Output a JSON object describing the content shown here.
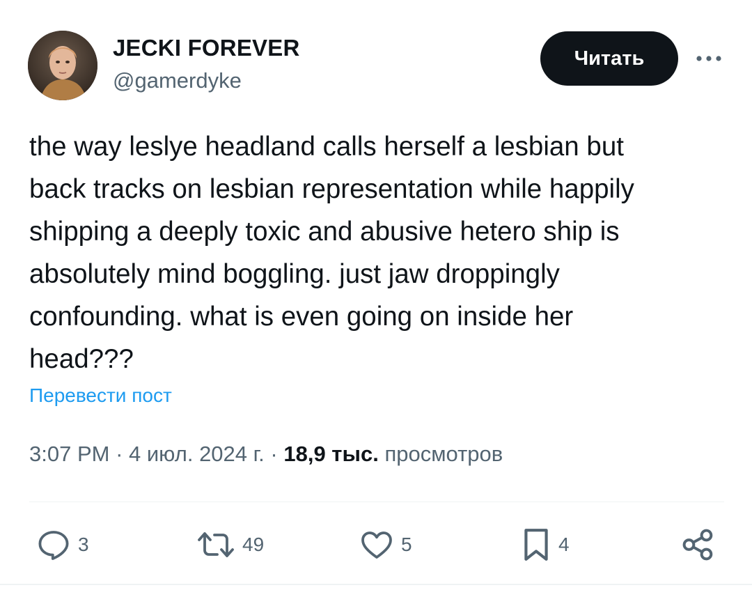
{
  "author": {
    "display_name": "JECKI FOREVER",
    "handle": "@gamerdyke"
  },
  "header": {
    "follow_label": "Читать",
    "more_icon": "more-horizontal-icon"
  },
  "tweet": {
    "lines": [
      "the way leslye headland calls herself a lesbian but",
      "back tracks on lesbian representation while happily",
      "shipping a deeply toxic and abusive hetero ship is",
      "absolutely mind boggling. just jaw droppingly",
      "confounding. what is even going on inside her",
      "head???"
    ],
    "translate_label": "Перевести пост"
  },
  "meta": {
    "time": "3:07 PM",
    "separator": " · ",
    "date": "4 июл. 2024 г.",
    "views_count": "18,9 тыс.",
    "views_label": "просмотров"
  },
  "actions": {
    "replies": "3",
    "reposts": "49",
    "likes": "5",
    "bookmarks": "4"
  },
  "colors": {
    "accent": "#1d9bf0",
    "secondary_text": "#536471",
    "primary_text": "#0f1419"
  }
}
